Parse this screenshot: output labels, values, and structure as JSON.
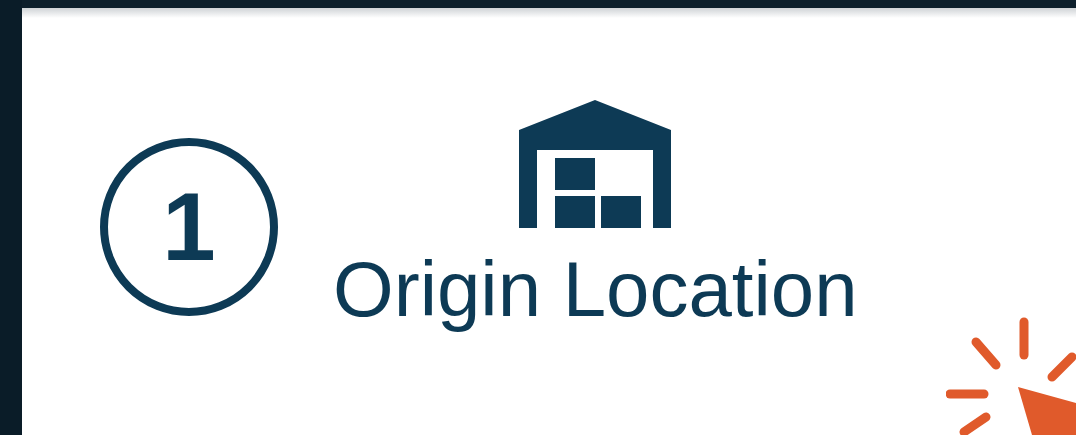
{
  "step": {
    "number": "1"
  },
  "origin": {
    "label": "Origin Location"
  }
}
